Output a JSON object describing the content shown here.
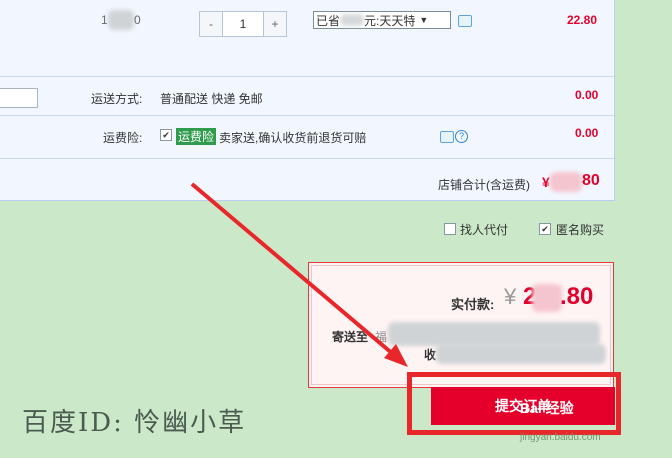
{
  "item": {
    "code_fragment": "1",
    "code_tail": "0",
    "qty_minus": "-",
    "quantity": "1",
    "qty_plus": "+",
    "promo_prefix": "已省",
    "promo_suffix": "元:天天特",
    "promo_arrow": "▼",
    "price": "22.80"
  },
  "shipping": {
    "label": "运送方式:",
    "value": "普通配送 快递 免邮",
    "amount": "0.00"
  },
  "insurance": {
    "label": "运费险:",
    "check": "✔",
    "tag": "运费险",
    "text": "卖家送,确认收货前退货可赔",
    "q": "?",
    "amount": "0.00"
  },
  "shop_total": {
    "label": "店铺合计(含运费)",
    "currency": "¥",
    "tail": "80"
  },
  "options": {
    "proxy_pay": "找人代付",
    "anonymous": "匿名购买",
    "anon_check": "✔"
  },
  "payment": {
    "label": "实付款:",
    "currency": "¥",
    "amount_head": "2",
    "amount_tail": ".80",
    "address_label": "寄送至",
    "address_start": "福",
    "receiver_fragment": "收"
  },
  "submit_label": "提交订单",
  "watermark": "百度ID: 怜幽小草",
  "logo_text": "Bai 经验",
  "logo_url": "jingyan.baidu.com",
  "colors": {
    "accent": "#e4002b",
    "background": "#cbe8c9",
    "panel": "#f2f7ff"
  }
}
